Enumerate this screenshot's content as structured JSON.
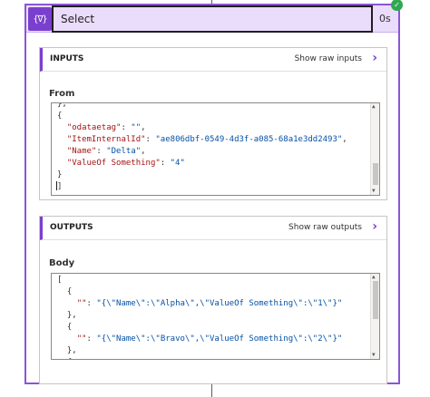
{
  "action": {
    "icon": "select-action-icon",
    "icon_glyph": "{∇}",
    "title": "Select",
    "duration": "0s",
    "status": "succeeded",
    "status_glyph": "✓"
  },
  "inputs": {
    "section_title": "INPUTS",
    "raw_link": "Show raw inputs",
    "chevron": "›",
    "field_label": "From",
    "code_lines": [
      [
        {
          "t": "p",
          "v": "},"
        }
      ],
      [
        {
          "t": "p",
          "v": "{"
        }
      ],
      [
        {
          "t": "p",
          "v": "  "
        },
        {
          "t": "k",
          "v": "\"odataetag\""
        },
        {
          "t": "p",
          "v": ": "
        },
        {
          "t": "s",
          "v": "\"\""
        },
        {
          "t": "p",
          "v": ","
        }
      ],
      [
        {
          "t": "p",
          "v": "  "
        },
        {
          "t": "k",
          "v": "\"ItemInternalId\""
        },
        {
          "t": "p",
          "v": ": "
        },
        {
          "t": "s",
          "v": "\"ae806dbf-0549-4d3f-a085-68a1e3dd2493\""
        },
        {
          "t": "p",
          "v": ","
        }
      ],
      [
        {
          "t": "p",
          "v": "  "
        },
        {
          "t": "k",
          "v": "\"Name\""
        },
        {
          "t": "p",
          "v": ": "
        },
        {
          "t": "s",
          "v": "\"Delta\""
        },
        {
          "t": "p",
          "v": ","
        }
      ],
      [
        {
          "t": "p",
          "v": "  "
        },
        {
          "t": "k",
          "v": "\"ValueOf Something\""
        },
        {
          "t": "p",
          "v": ": "
        },
        {
          "t": "s",
          "v": "\"4\""
        }
      ],
      [
        {
          "t": "p",
          "v": "}"
        }
      ],
      [
        {
          "t": "p",
          "v": "]"
        }
      ]
    ]
  },
  "outputs": {
    "section_title": "OUTPUTS",
    "raw_link": "Show raw outputs",
    "chevron": "›",
    "field_label": "Body",
    "code_lines": [
      [
        {
          "t": "p",
          "v": "["
        }
      ],
      [
        {
          "t": "p",
          "v": "  {"
        }
      ],
      [
        {
          "t": "p",
          "v": "    "
        },
        {
          "t": "k",
          "v": "\"\""
        },
        {
          "t": "p",
          "v": ": "
        },
        {
          "t": "s",
          "v": "\"{\\\"Name\\\":\\\"Alpha\\\",\\\"ValueOf Something\\\":\\\"1\\\"}\""
        }
      ],
      [
        {
          "t": "p",
          "v": "  },"
        }
      ],
      [
        {
          "t": "p",
          "v": "  {"
        }
      ],
      [
        {
          "t": "p",
          "v": "    "
        },
        {
          "t": "k",
          "v": "\"\""
        },
        {
          "t": "p",
          "v": ": "
        },
        {
          "t": "s",
          "v": "\"{\\\"Name\\\":\\\"Bravo\\\",\\\"ValueOf Something\\\":\\\"2\\\"}\""
        }
      ],
      [
        {
          "t": "p",
          "v": "  },"
        }
      ],
      [
        {
          "t": "p",
          "v": "  {"
        }
      ]
    ]
  },
  "scrollbar": {
    "up": "▲",
    "down": "▼"
  }
}
